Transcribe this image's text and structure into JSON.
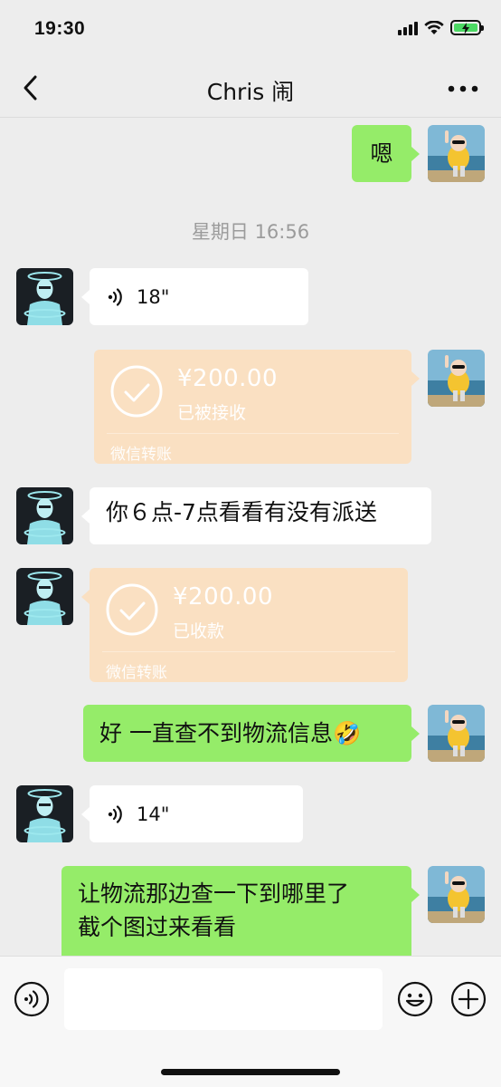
{
  "status_bar": {
    "time": "19:30",
    "battery_color": "#4cd964"
  },
  "nav": {
    "title": "Chris 闹",
    "back_icon": "chevron-left-icon",
    "more_icon": "more-horizontal-icon"
  },
  "messages": {
    "m1": {
      "text": "嗯"
    },
    "divider": {
      "text": "星期日 16:56"
    },
    "m2": {
      "duration": "18\""
    },
    "m3": {
      "amount": "¥200.00",
      "status": "已被接收",
      "label": "微信转账"
    },
    "m4": {
      "text": "你６点-7点看看有没有派送"
    },
    "m5": {
      "amount": "¥200.00",
      "status": "已收款",
      "label": "微信转账"
    },
    "m6": {
      "text": "好 一直查不到物流信息",
      "emoji": "🤣"
    },
    "m7": {
      "duration": "14\""
    },
    "m8": {
      "line1": "让物流那边查一下到哪里了",
      "line2": "截个图过来看看"
    }
  },
  "input_bar": {
    "placeholder": "",
    "value": ""
  },
  "colors": {
    "green_bubble": "#95ec69",
    "transfer_bubble": "#fae0c2",
    "background": "#ededed"
  }
}
